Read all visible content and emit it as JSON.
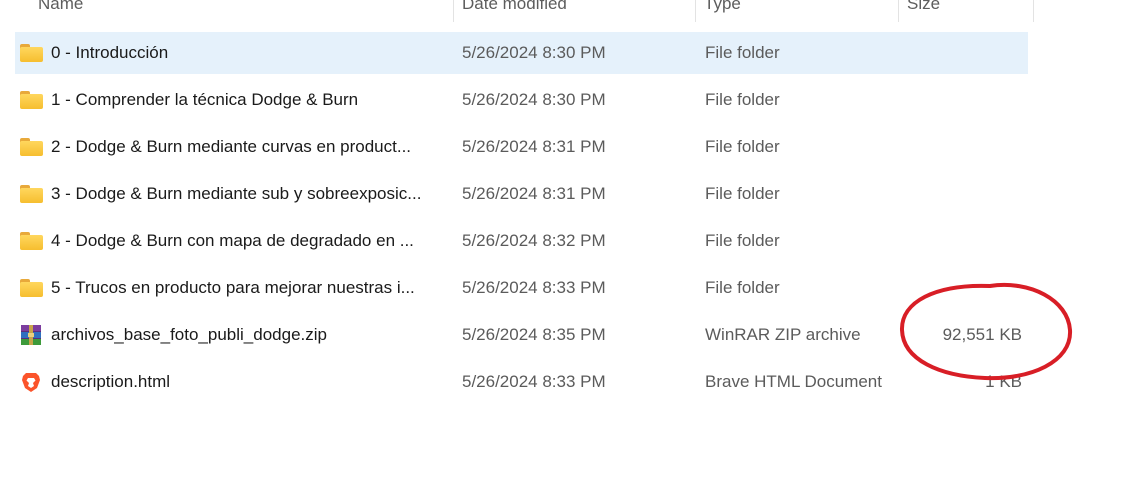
{
  "columns": {
    "name": "Name",
    "date": "Date modified",
    "type": "Type",
    "size": "Size"
  },
  "files": [
    {
      "icon": "folder-icon",
      "name": "0 - Introducción",
      "date": "5/26/2024 8:30 PM",
      "type": "File folder",
      "size": "",
      "selected": true
    },
    {
      "icon": "folder-icon",
      "name": "1 - Comprender la técnica Dodge & Burn",
      "date": "5/26/2024 8:30 PM",
      "type": "File folder",
      "size": ""
    },
    {
      "icon": "folder-icon",
      "name": "2 - Dodge & Burn mediante curvas en product...",
      "date": "5/26/2024 8:31 PM",
      "type": "File folder",
      "size": ""
    },
    {
      "icon": "folder-icon",
      "name": "3 - Dodge & Burn mediante sub y sobreexposic...",
      "date": "5/26/2024 8:31 PM",
      "type": "File folder",
      "size": ""
    },
    {
      "icon": "folder-icon",
      "name": "4 - Dodge & Burn con mapa de degradado en ...",
      "date": "5/26/2024 8:32 PM",
      "type": "File folder",
      "size": ""
    },
    {
      "icon": "folder-icon",
      "name": "5 - Trucos en producto para mejorar nuestras i...",
      "date": "5/26/2024 8:33 PM",
      "type": "File folder",
      "size": ""
    },
    {
      "icon": "winrar-zip-icon",
      "name": "archivos_base_foto_publi_dodge.zip",
      "date": "5/26/2024 8:35 PM",
      "type": "WinRAR ZIP archive",
      "size": "92,551 KB"
    },
    {
      "icon": "brave-icon",
      "name": "description.html",
      "date": "5/26/2024 8:33 PM",
      "type": "Brave HTML Document",
      "size": "1 KB"
    }
  ],
  "colors": {
    "selection": "#e5f1fb",
    "annotation_circle": "#d81e26",
    "folder": "#f6be2f"
  }
}
